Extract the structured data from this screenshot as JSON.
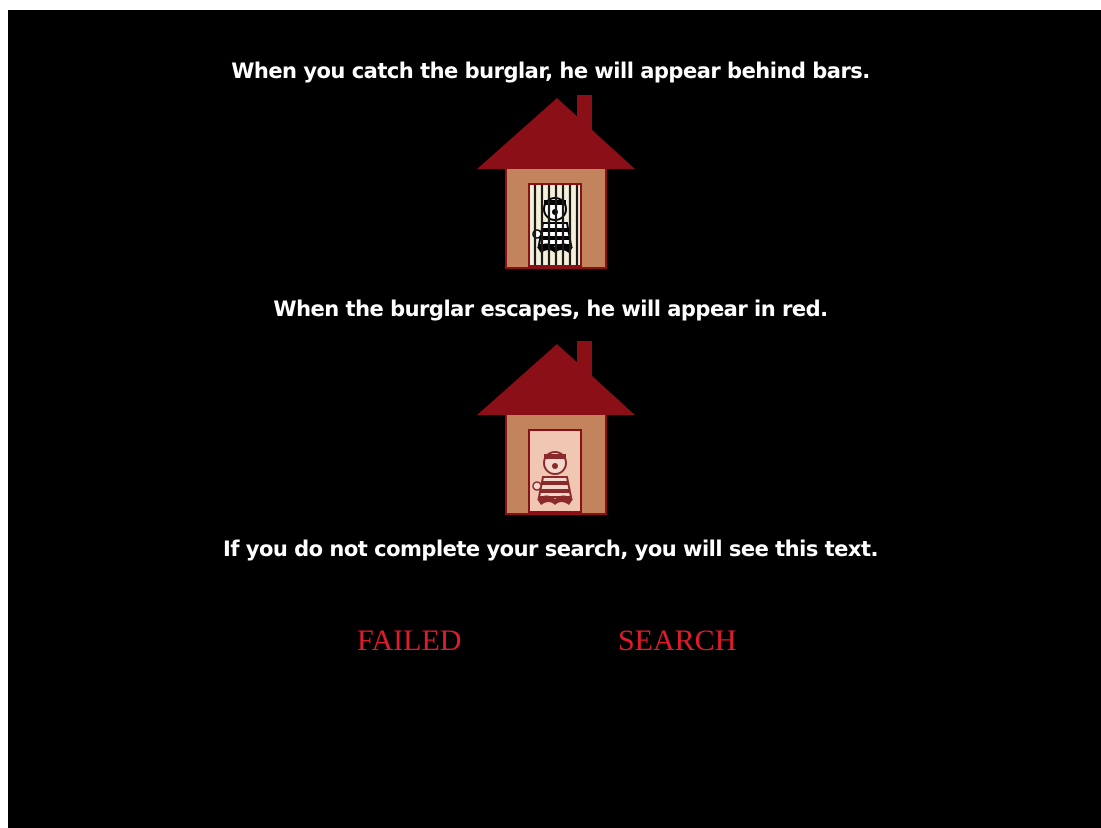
{
  "instructions": {
    "caught_text": "When you catch the burglar, he will appear behind bars.",
    "escaped_text": "When the burglar escapes, he will appear in red.",
    "incomplete_text": "If you do not complete your search, you will see this text."
  },
  "status": {
    "failed_label": "FAILED",
    "search_label": "SEARCH"
  },
  "icons": {
    "caught_house": "house-with-jailed-burglar-icon",
    "escaped_house": "house-with-red-burglar-icon"
  },
  "colors": {
    "background": "#000000",
    "text": "#ffffff",
    "roof": "#8a0f17",
    "wall": "#c3845d",
    "status_text": "#e01b2b"
  }
}
